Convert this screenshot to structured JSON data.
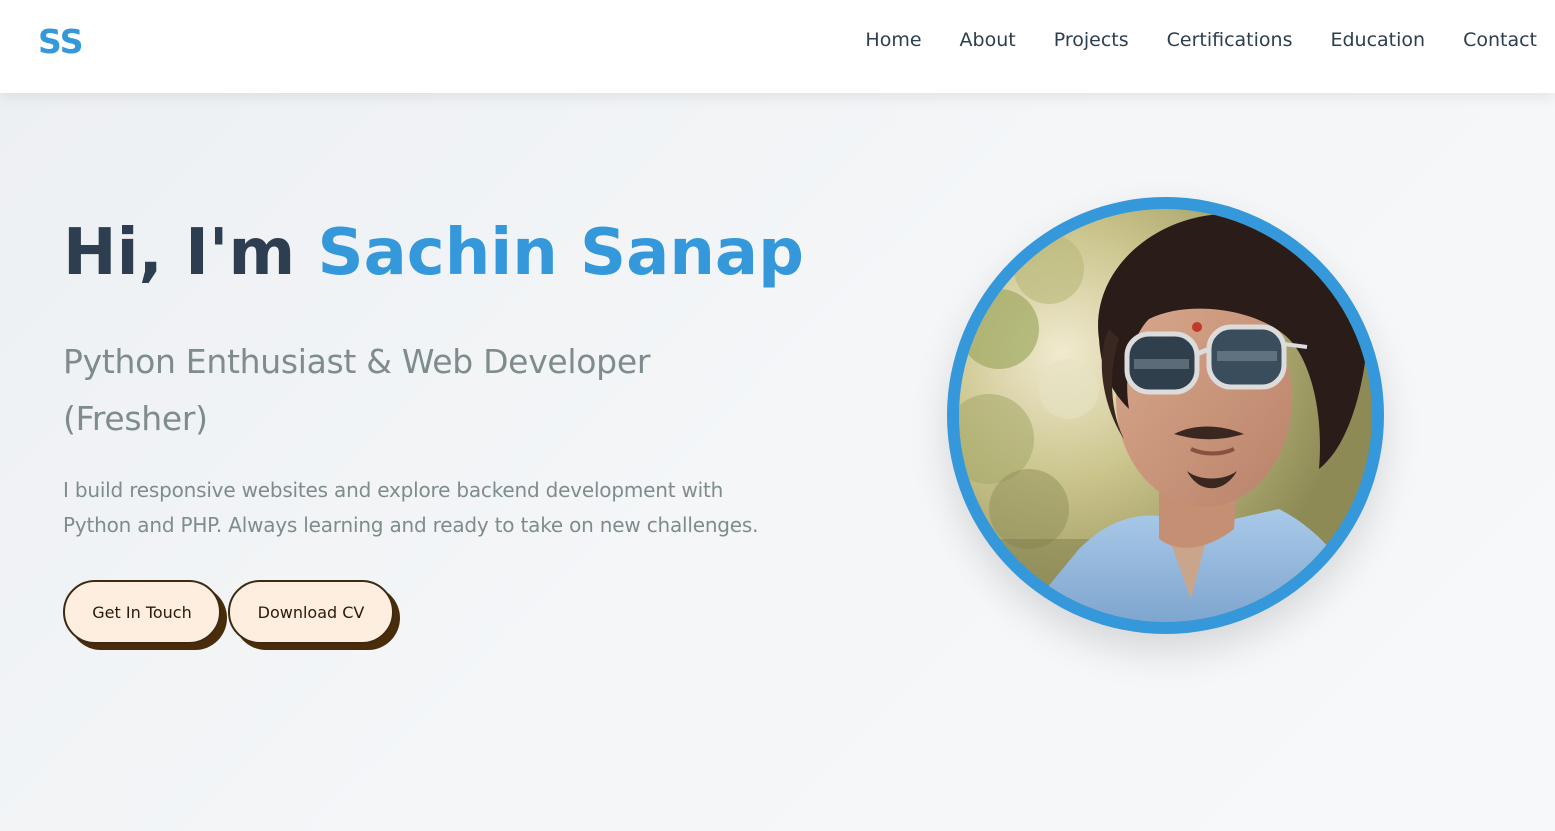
{
  "header": {
    "logo": "SS",
    "nav": [
      "Home",
      "About",
      "Projects",
      "Certifications",
      "Education",
      "Contact"
    ]
  },
  "hero": {
    "greeting": "Hi, I'm ",
    "name": "Sachin Sanap",
    "subtitle_line1": "Python Enthusiast & Web Developer",
    "subtitle_line2": "(Fresher)",
    "description_line1": "I build responsive websites and explore backend development with",
    "description_line2": "Python and PHP. Always learning and ready to take on new challenges.",
    "buttons": {
      "contact": "Get In Touch",
      "cv": "Download CV"
    }
  },
  "colors": {
    "accent": "#3498db",
    "heading": "#2c3e50",
    "muted": "#7f8c8d",
    "button_bg": "#fdeee0",
    "button_shadow": "#4a2c0a"
  },
  "icons": {
    "profile": "profile-photo"
  }
}
